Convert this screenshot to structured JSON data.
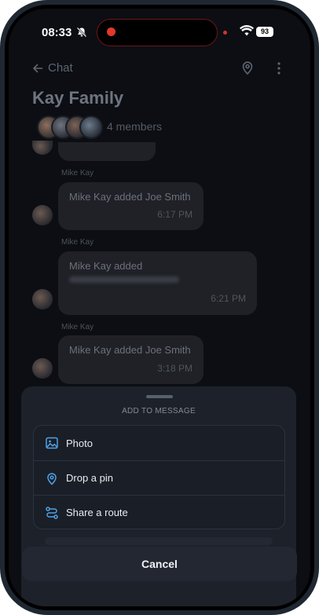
{
  "status_bar": {
    "time": "08:33",
    "battery": "93"
  },
  "header": {
    "back_label": "Chat",
    "title": "Kay Family",
    "members": "4 members"
  },
  "messages": [
    {
      "sender": "Mike Kay",
      "text": "Mike Kay added Joe Smith",
      "time": "6:17 PM"
    },
    {
      "sender": "Mike Kay",
      "text": "Mike Kay added",
      "time": "6:21 PM"
    },
    {
      "sender": "Mike Kay",
      "text": "Mike Kay added Joe Smith",
      "time": "3:18 PM"
    }
  ],
  "sheet": {
    "title": "ADD TO MESSAGE",
    "options": [
      {
        "label": "Photo",
        "icon": "image-icon"
      },
      {
        "label": "Drop a pin",
        "icon": "map-pin-icon"
      },
      {
        "label": "Share a route",
        "icon": "route-icon"
      }
    ],
    "cancel_label": "Cancel"
  },
  "colors": {
    "accent": "#4da3e6",
    "background": "#0c0e13",
    "sheet": "#1c212a"
  }
}
